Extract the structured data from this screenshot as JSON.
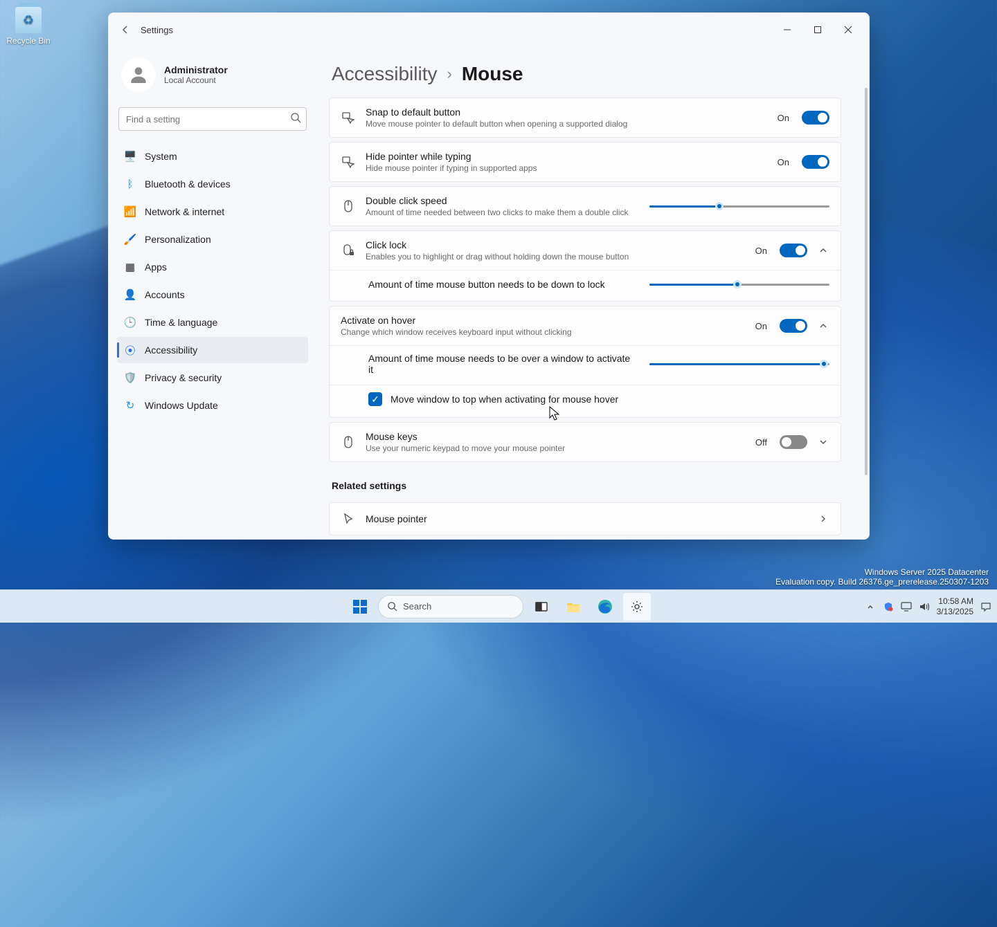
{
  "desktop": {
    "recycle_bin": "Recycle Bin"
  },
  "watermark": {
    "line1": "Windows Server 2025 Datacenter",
    "line2": "Evaluation copy. Build 26376.ge_prerelease.250307-1203"
  },
  "window": {
    "title": "Settings",
    "profile": {
      "name": "Administrator",
      "sub": "Local Account"
    },
    "search_placeholder": "Find a setting",
    "nav": [
      {
        "key": "system",
        "label": "System",
        "icon": "🖥️"
      },
      {
        "key": "bluetooth",
        "label": "Bluetooth & devices",
        "icon": "ᛒ",
        "color": "#1f8fe6"
      },
      {
        "key": "network",
        "label": "Network & internet",
        "icon": "📶",
        "color": "#1f8fe6"
      },
      {
        "key": "personalization",
        "label": "Personalization",
        "icon": "🖌️"
      },
      {
        "key": "apps",
        "label": "Apps",
        "icon": "▦"
      },
      {
        "key": "accounts",
        "label": "Accounts",
        "icon": "👤",
        "color": "#2fa36b"
      },
      {
        "key": "time",
        "label": "Time & language",
        "icon": "🕒"
      },
      {
        "key": "accessibility",
        "label": "Accessibility",
        "icon": "⦿",
        "active": true,
        "color": "#1f6fd0"
      },
      {
        "key": "privacy",
        "label": "Privacy & security",
        "icon": "🛡️"
      },
      {
        "key": "update",
        "label": "Windows Update",
        "icon": "↻",
        "color": "#1f8fe6"
      }
    ],
    "breadcrumb": {
      "parent": "Accessibility",
      "current": "Mouse"
    },
    "rows": {
      "snap": {
        "title": "Snap to default button",
        "desc": "Move mouse pointer to default button when opening a supported dialog",
        "state": "On"
      },
      "hide": {
        "title": "Hide pointer while typing",
        "desc": "Hide mouse pointer if typing in supported apps",
        "state": "On"
      },
      "dbl": {
        "title": "Double click speed",
        "desc": "Amount of time needed between two clicks to make them a double click",
        "slider_pct": 40
      },
      "lock": {
        "title": "Click lock",
        "desc": "Enables you to highlight or drag without holding down the mouse button",
        "state": "On",
        "sub_label": "Amount of time mouse button needs to be down to lock",
        "sub_slider_pct": 50
      },
      "hover": {
        "title": "Activate on hover",
        "desc": "Change which window receives keyboard input without clicking",
        "state": "On",
        "sub_label": "Amount of time mouse needs to be over a window to activate it",
        "sub_slider_pct": 98,
        "check_label": "Move window to top when activating for mouse hover",
        "checked": true
      },
      "mkeys": {
        "title": "Mouse keys",
        "desc": "Use your numeric keypad to move your mouse pointer",
        "state": "Off"
      }
    },
    "related_heading": "Related settings",
    "related_item": "Mouse pointer"
  },
  "taskbar": {
    "search_placeholder": "Search",
    "time": "10:58 AM",
    "date": "3/13/2025"
  }
}
